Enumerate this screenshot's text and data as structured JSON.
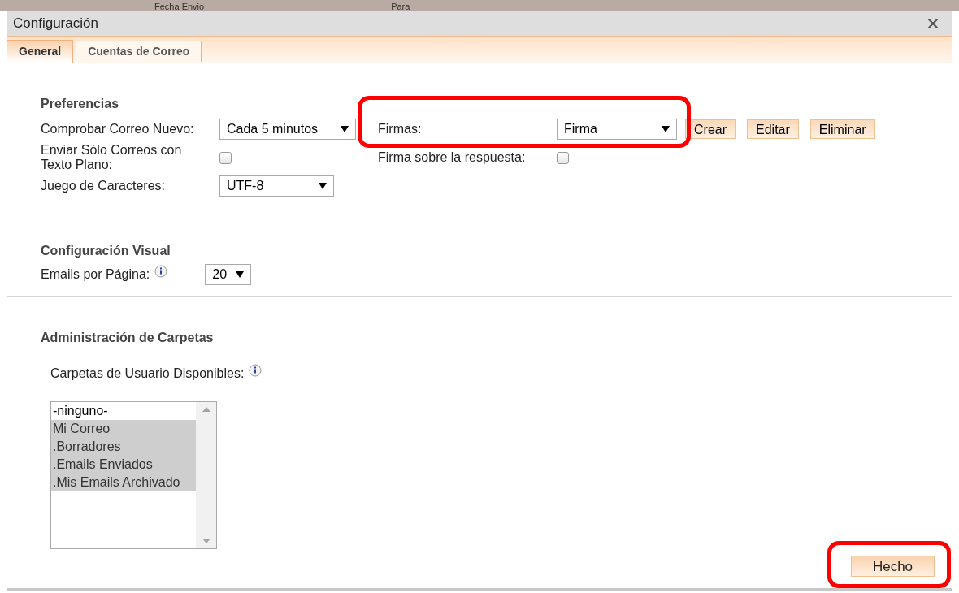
{
  "background_headers": [
    "Fecha Envio",
    "Para"
  ],
  "window": {
    "title": "Configuración"
  },
  "tabs": [
    {
      "label": "General",
      "selected": true
    },
    {
      "label": "Cuentas de Correo",
      "selected": false
    }
  ],
  "preferences": {
    "heading": "Preferencias",
    "check_mail": {
      "label": "Comprobar Correo Nuevo:",
      "value": "Cada 5 minutos"
    },
    "plain_text": {
      "label": "Enviar Sólo Correos con Texto Plano:",
      "checked": false
    },
    "charset": {
      "label": "Juego de Caracteres:",
      "value": "UTF-8"
    },
    "signatures": {
      "label": "Firmas:",
      "value": "Firma",
      "highlighted": true,
      "buttons": [
        "Crear",
        "Editar",
        "Eliminar"
      ]
    },
    "signature_above_reply": {
      "label": "Firma sobre la respuesta:",
      "checked": false
    }
  },
  "visual": {
    "heading": "Configuración Visual",
    "emails_per_page": {
      "label": "Emails por Página:",
      "value": "20"
    }
  },
  "folders": {
    "heading": "Administración de Carpetas",
    "label": "Carpetas de Usuario Disponibles:",
    "items": [
      {
        "label": "-ninguno-",
        "selected": false
      },
      {
        "label": "Mi Correo",
        "selected": true
      },
      {
        "label": ".Borradores",
        "selected": true
      },
      {
        "label": ".Emails Enviados",
        "selected": true
      },
      {
        "label": ".Mis Emails Archivado",
        "selected": true
      }
    ]
  },
  "done_button": {
    "label": "Hecho",
    "highlighted": true
  }
}
